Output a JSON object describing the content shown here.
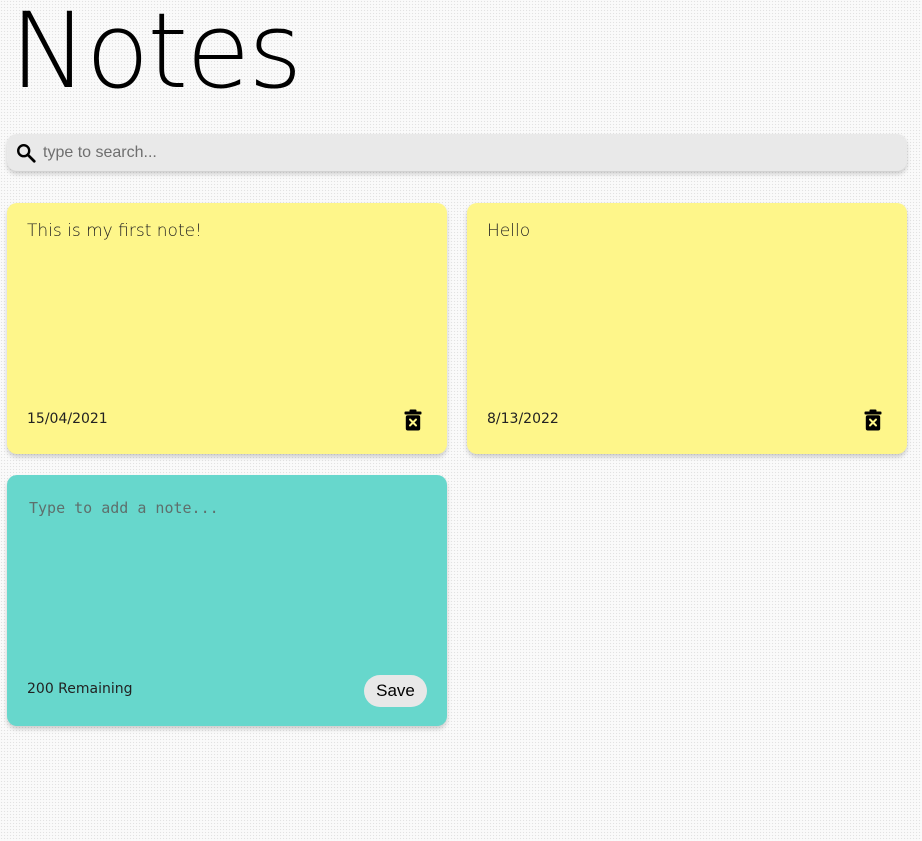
{
  "header": {
    "title": "Notes"
  },
  "search": {
    "placeholder": "type to search...",
    "value": "",
    "icon": "search-icon"
  },
  "notes": [
    {
      "text": "This is my first note!",
      "date": "15/04/2021",
      "color": "#fef68a",
      "delete_icon": "trash-icon"
    },
    {
      "text": "Hello",
      "date": "8/13/2022",
      "color": "#fef68a",
      "delete_icon": "trash-icon"
    }
  ],
  "add_note": {
    "placeholder": "Type to add a note...",
    "value": "",
    "remaining_label": "200 Remaining",
    "save_label": "Save",
    "color": "#67d7cc"
  }
}
